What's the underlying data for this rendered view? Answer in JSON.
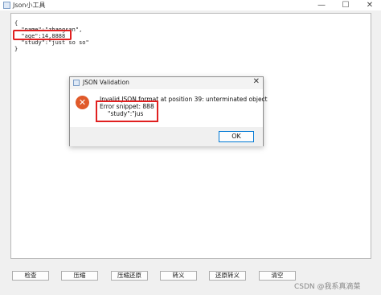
{
  "window": {
    "title": "Json小工具",
    "minimize": "—",
    "maximize": "☐",
    "close": "✕"
  },
  "editor": {
    "lines": [
      "{",
      "  \"name\":\"zhangsan\",",
      "  \"age\":14,8888",
      "  \"study\":\"just so so\"",
      "}"
    ]
  },
  "buttons": {
    "check": "检查",
    "compress": "压缩",
    "compress_restore": "压缩还原",
    "escape": "转义",
    "unescape": "还原转义",
    "clear": "清空"
  },
  "dialog": {
    "title": "JSON Validation",
    "close": "✕",
    "icon": "✕",
    "message": "Invalid JSON format at position 39: unterminated object",
    "snippet_label": "Error snippet: 888",
    "snippet_text": "\"study\":\"jus",
    "ok": "OK"
  },
  "watermark": "CSDN @我系真滴菜",
  "colors": {
    "highlight": "#e02020",
    "error_icon": "#e05a2a",
    "ok_border": "#0078d4"
  }
}
